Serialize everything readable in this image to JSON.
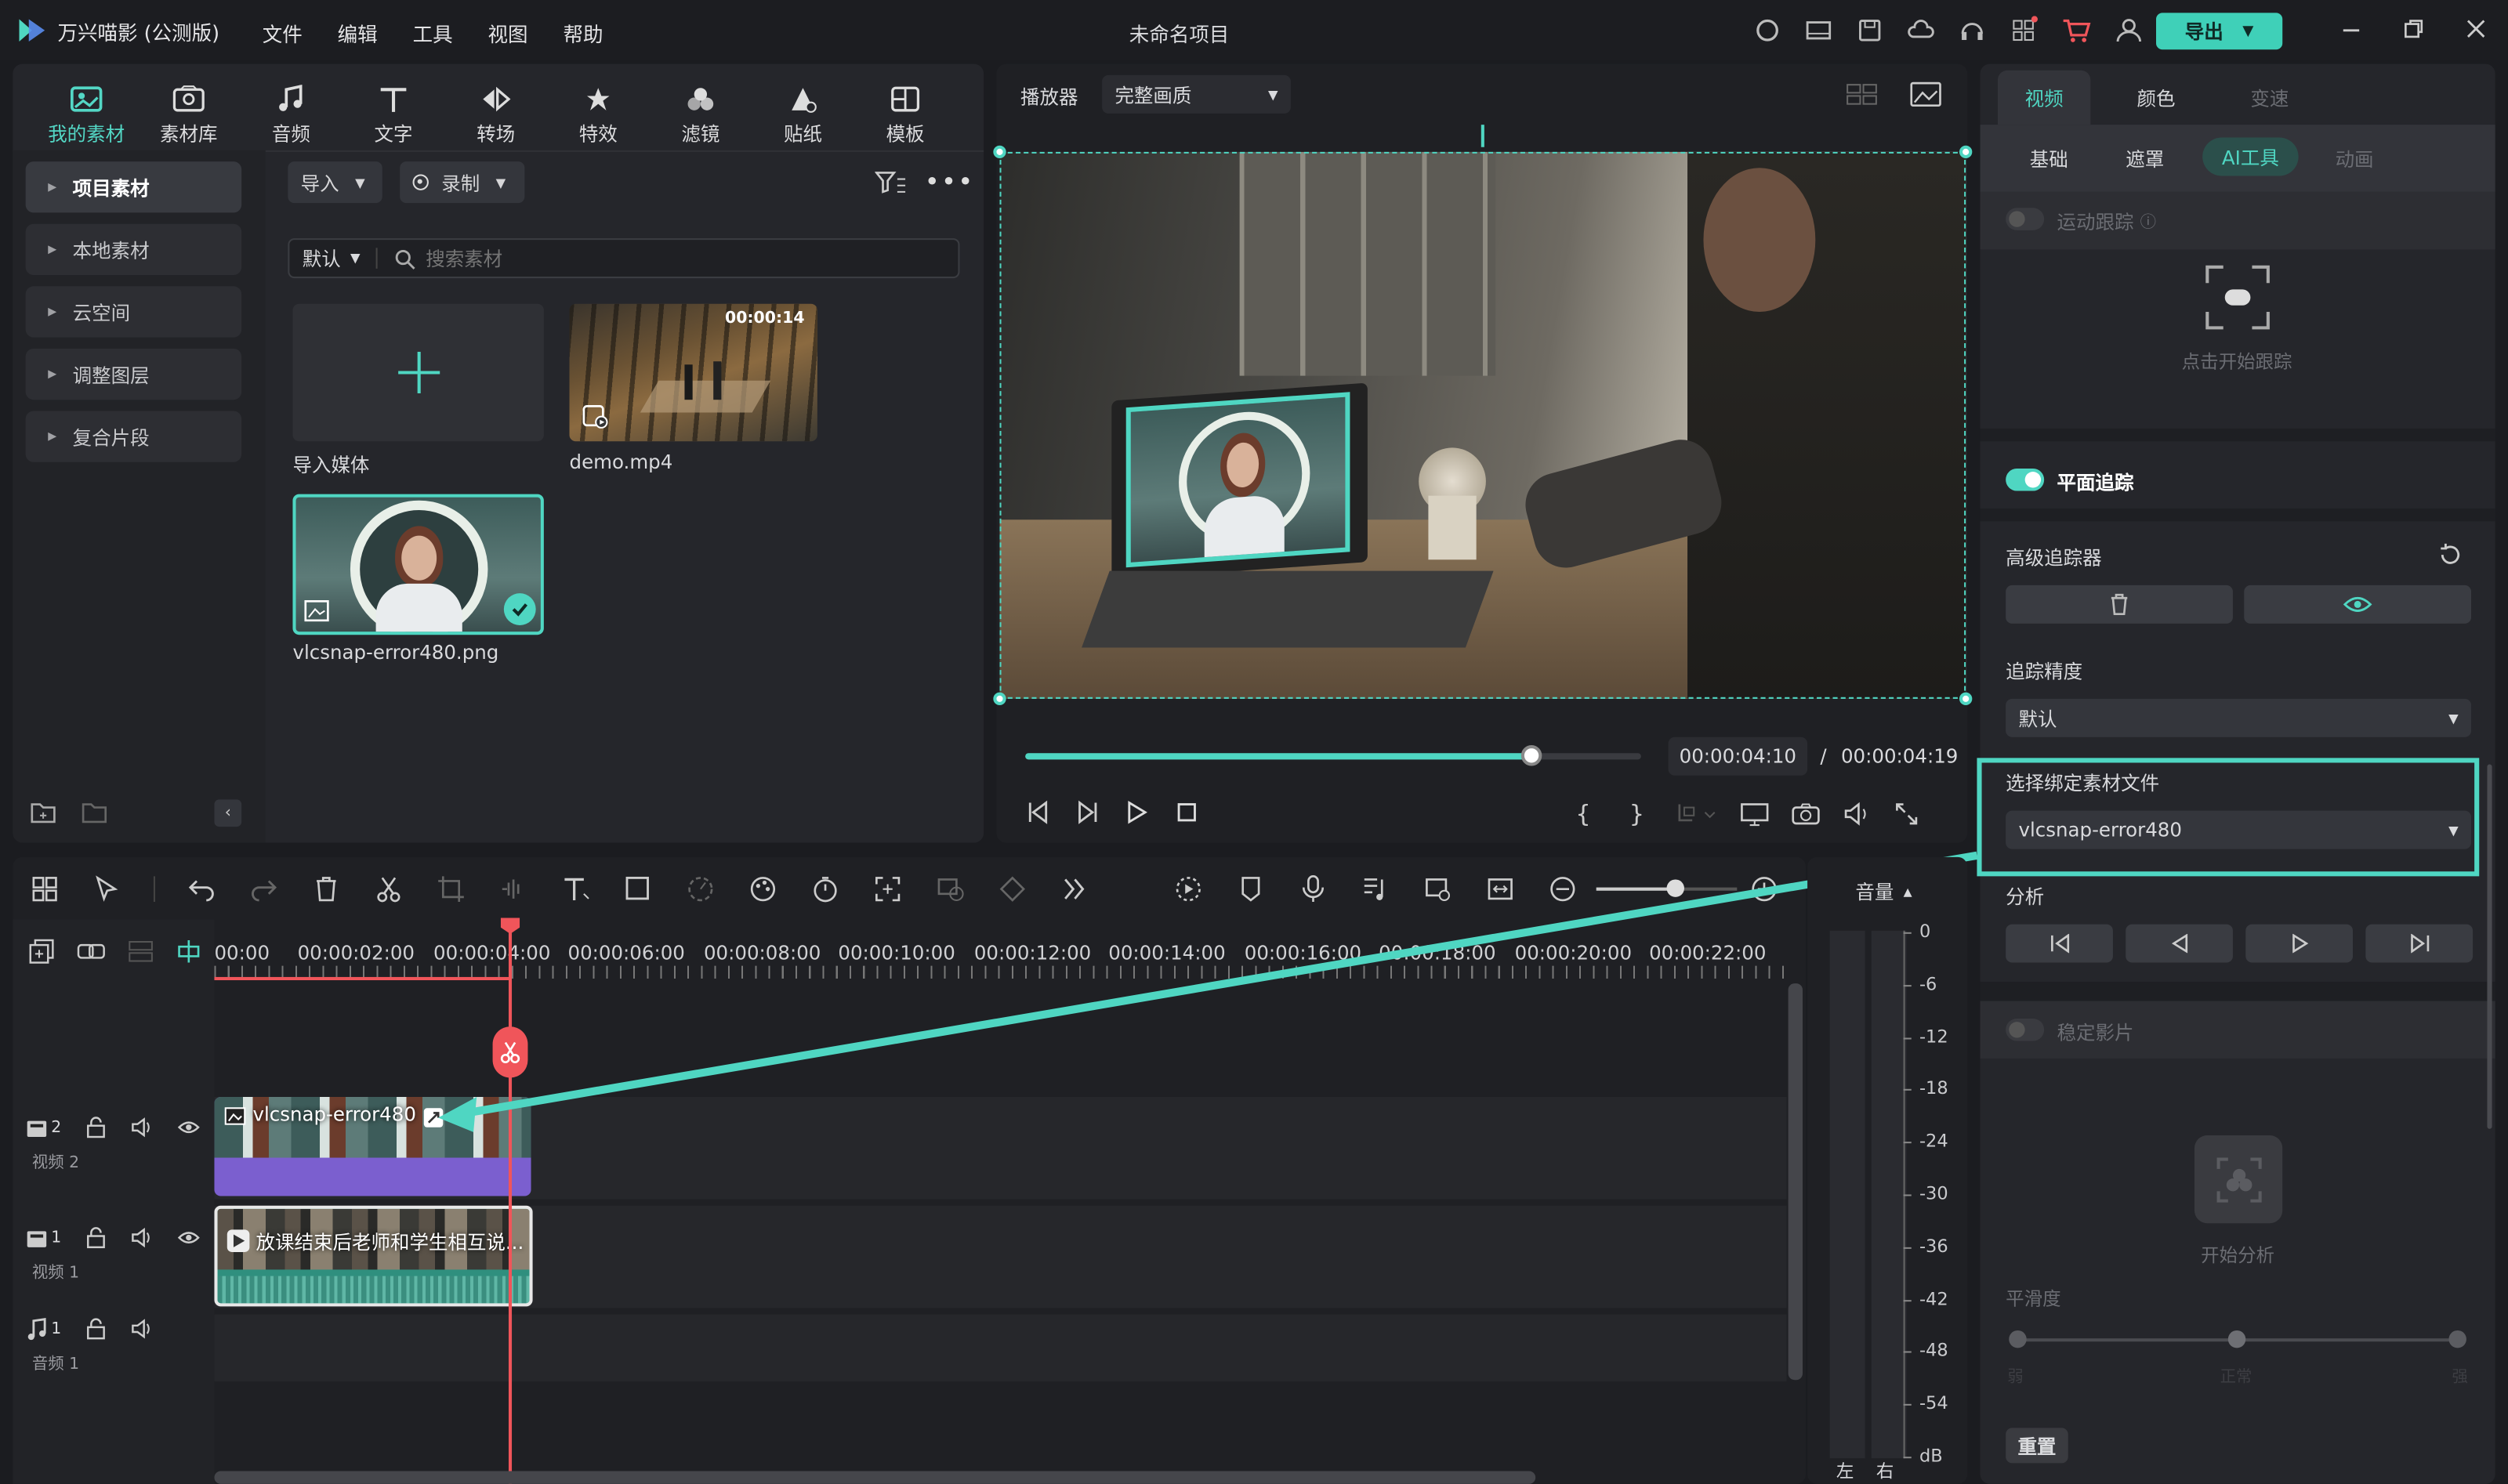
{
  "app": {
    "title": "万兴喵影 (公测版)",
    "project": "未命名项目",
    "export": "导出"
  },
  "menu": [
    "文件",
    "编辑",
    "工具",
    "视图",
    "帮助"
  ],
  "nav": [
    "我的素材",
    "素材库",
    "音频",
    "文字",
    "转场",
    "特效",
    "滤镜",
    "贴纸",
    "模板"
  ],
  "sidebar": [
    "项目素材",
    "本地素材",
    "云空间",
    "调整图层",
    "复合片段"
  ],
  "media": {
    "import": "导入",
    "record": "录制",
    "sort": "默认",
    "search_placeholder": "搜索素材",
    "items": [
      {
        "name": "导入媒体"
      },
      {
        "name": "demo.mp4",
        "duration": "00:00:14"
      },
      {
        "name": "vlcsnap-error480.png"
      }
    ]
  },
  "player": {
    "label": "播放器",
    "quality": "完整画质",
    "current": "00:00:04:10",
    "sep": "/",
    "total": "00:00:04:19",
    "progress": 0.82
  },
  "right": {
    "tabs": [
      "视频",
      "颜色",
      "变速"
    ],
    "subtabs": [
      "基础",
      "遮罩",
      "AI工具",
      "动画"
    ],
    "motion_track": "运动跟踪",
    "click_track": "点击开始跟踪",
    "planar": "平面追踪",
    "advanced": "高级追踪器",
    "precision": "追踪精度",
    "precision_value": "默认",
    "bind_label": "选择绑定素材文件",
    "bind_value": "vlcsnap-error480",
    "analyze": "分析",
    "stabilize": "稳定影片",
    "start_analyze": "开始分析",
    "smooth": "平滑度",
    "reset": "重置",
    "smooth_marks": [
      "弱",
      "正常",
      "强"
    ]
  },
  "timeline": {
    "ticks": [
      "00:00",
      "00:00:02:00",
      "00:00:04:00",
      "00:00:06:00",
      "00:00:08:00",
      "00:00:10:00",
      "00:00:12:00",
      "00:00:14:00",
      "00:00:16:00",
      "00:00:18:00",
      "00:00:20:00",
      "00:00:22:00"
    ],
    "tracks": [
      {
        "num": "2",
        "name": "视频 2"
      },
      {
        "num": "1",
        "name": "视频 1"
      },
      {
        "num": "1",
        "name": "音频 1"
      }
    ],
    "clip1": "vlcsnap-error480",
    "clip2": "放课结束后老师和学生相互说..."
  },
  "meter": {
    "label": "音量",
    "scale": [
      "0",
      "-6",
      "-12",
      "-18",
      "-24",
      "-30",
      "-36",
      "-42",
      "-48",
      "-54",
      "dB"
    ],
    "lr": [
      "左",
      "右"
    ]
  },
  "colors": {
    "accent": "#4fd6c2",
    "purple": "#7b5fcf",
    "teal": "#2f8f7e",
    "playhead": "#f0555a"
  }
}
